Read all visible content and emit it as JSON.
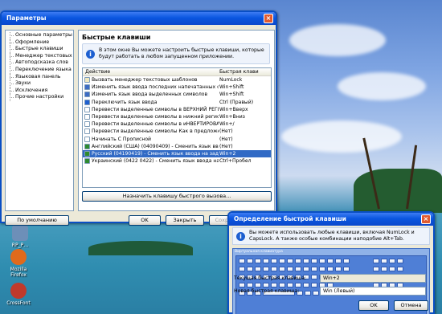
{
  "desktop": {
    "icons": [
      {
        "label": "RP_P…",
        "color": "#6d8fb8"
      },
      {
        "label": "Mozilla Firefox",
        "color": "#e06a1c"
      },
      {
        "label": "CrossFont",
        "color": "#c0392b"
      }
    ]
  },
  "params_window": {
    "title": "Параметры",
    "close": "×",
    "tree": [
      "Основные параметры",
      "Оформление",
      "Быстрые клавиши",
      "Менеджер текстовых шаб",
      "Автоподсказка слов",
      "Переключение языка ввод",
      "Языковая панель",
      "Звуки",
      "Исключения",
      "Прочие настройки"
    ],
    "panel_title": "Быстрые клавиши",
    "info": "В этом окне Вы можете настроить быстрые клавиши, которые будут работать в любом запущенном приложении.",
    "col_action": "Действие",
    "col_key": "Быстрая клави",
    "rows": [
      {
        "action": "Вызвать менеджер текстовых шаблонов",
        "key": "NumLock",
        "icon": "#f0e9c0"
      },
      {
        "action": "Изменить язык ввода последних напечатанных симво",
        "key": "Win+Shift",
        "icon": "#3d6cc4"
      },
      {
        "action": "Изменить язык ввода выделенных символов",
        "key": "Win+Shift",
        "icon": "#3d6cc4"
      },
      {
        "action": "Переключить язык ввода",
        "key": "Ctrl (Правый)",
        "icon": "#1d5fd0"
      },
      {
        "action": "Перевести выделенные символы в ВЕРХНИЙ РЕГИСТР",
        "key": "Win+Вверх",
        "icon": "#ffffff"
      },
      {
        "action": "Перевести выделенные символы в нижний регистр",
        "key": "Win+Вниз",
        "icon": "#ffffff"
      },
      {
        "action": "Перевести выделенные символы в иНВЕРТИРОВАННЫ",
        "key": "Win+/",
        "icon": "#ffffff"
      },
      {
        "action": "Перевести выделенные символы Как в предложении.",
        "key": "(Нет)",
        "icon": "#ffffff"
      },
      {
        "action": "Начинать С Прописной",
        "key": "(Нет)",
        "icon": "#ffffff"
      },
      {
        "action": "Английский (США) (04090409) - Сменить язык ввода ...",
        "key": "(Нет)",
        "icon": "#2e8b2e"
      },
      {
        "action": "Русский (04190419) - Сменить язык ввода на заданный",
        "key": "Win+2",
        "icon": "#2e8b2e"
      },
      {
        "action": "Украинский (0422 0422) - Сменить язык ввода на зад...",
        "key": "Ctrl+Пробел",
        "icon": "#2e8b2e"
      }
    ],
    "selected_row": 10,
    "assign_button": "Назначить клавишу быстрого вызова...",
    "defaults_button": "По умолчанию",
    "ok_button": "OK",
    "close_button": "Закрыть",
    "apply_button": "Сохран"
  },
  "dialog": {
    "title": "Определение быстрой клавиши",
    "close": "×",
    "info": "Вы можете использовать любые клавиши, включая NumLock и CapsLock. А также особые комбинации наподобие Alt+Tab.",
    "keyboard_title": "Виртуальная клавиатура",
    "current_label": "Текущая быстрая клавиша:",
    "current_value": "Win+2",
    "new_label": "Новая быстрая клавиша:",
    "new_value": "Win (Левый)",
    "ok_button": "OK",
    "cancel_button": "Отмена"
  }
}
